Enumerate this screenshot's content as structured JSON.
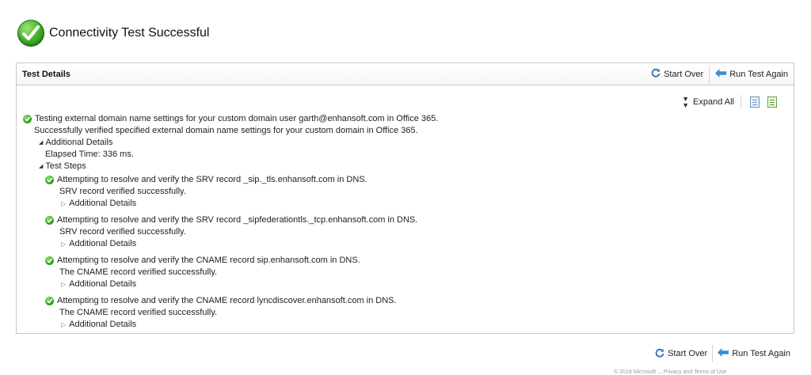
{
  "header": {
    "title": "Connectivity Test Successful"
  },
  "panel": {
    "title": "Test Details",
    "start_over": "Start Over",
    "run_again": "Run Test Again",
    "expand_all": "Expand All"
  },
  "summary": {
    "line1": "Testing external domain name settings for your custom domain user garth@enhansoft.com in Office 365.",
    "line2": "Successfully verified specified external domain name settings for your custom domain in Office 365.",
    "additional_details_label": "Additional Details",
    "elapsed": "Elapsed Time: 336 ms.",
    "test_steps_label": "Test Steps"
  },
  "steps": [
    {
      "title": "Attempting to resolve and verify the SRV record _sip._tls.enhansoft.com in DNS.",
      "result": "SRV record verified successfully.",
      "details": "Additional Details"
    },
    {
      "title": "Attempting to resolve and verify the SRV record _sipfederationtls._tcp.enhansoft.com in DNS.",
      "result": "SRV record verified successfully.",
      "details": "Additional Details"
    },
    {
      "title": "Attempting to resolve and verify the CNAME record sip.enhansoft.com in DNS.",
      "result": "The CNAME record verified successfully.",
      "details": "Additional Details"
    },
    {
      "title": "Attempting to resolve and verify the CNAME record lyncdiscover.enhansoft.com in DNS.",
      "result": "The CNAME record verified successfully.",
      "details": "Additional Details"
    }
  ],
  "bottom": {
    "start_over": "Start Over",
    "run_again": "Run Test Again"
  },
  "footer": {
    "text": "© 2019 Microsoft ... Privacy and Terms of Use"
  },
  "colors": {
    "success_green": "#3fae2a",
    "refresh_blue": "#2f6fb8",
    "arrow_blue": "#3d8bd6",
    "border": "#c8c8c8"
  },
  "icons": [
    "success-check-icon",
    "refresh-icon",
    "back-arrow-icon",
    "expand-all-icon",
    "html-export-icon",
    "excel-export-icon",
    "collapse-triangle-icon",
    "expand-triangle-icon"
  ]
}
